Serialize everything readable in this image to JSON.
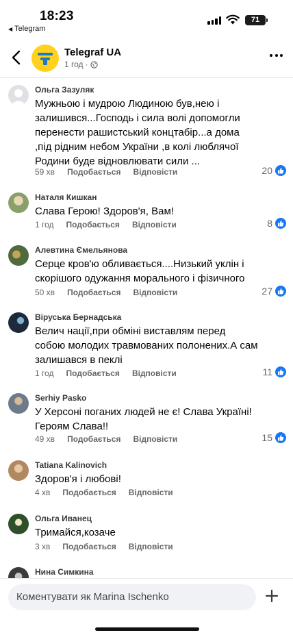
{
  "status_bar": {
    "time": "18:23",
    "back_app": "Telegram",
    "battery": "71"
  },
  "header": {
    "page_name": "Telegraf UA",
    "post_time": "1 год",
    "privacy_icon": "globe-icon"
  },
  "colors": {
    "accent": "#1877f2",
    "logo_bg": "#ffd21f",
    "logo_fg": "#1f7ac4",
    "meta": "#65676b"
  },
  "comments": [
    {
      "author": "Ольга Зазуляк",
      "text": "Мужньою і мудрою Людиною був,нею і залишився...Господь і сила волі допомогли перенести рашистський концтабір...а дома ,під рідним небом України ,в колі люблячої Родини буде відновлювати сили ...",
      "time": "59 хв",
      "like": "Подобається",
      "reply": "Відповісти",
      "reactions": "20"
    },
    {
      "author": "Наталя Кишкан",
      "text": "Слава Герою! Здоров'я, Вам!",
      "time": "1 год",
      "like": "Подобається",
      "reply": "Відповісти",
      "reactions": "8"
    },
    {
      "author": "Алевтина Ємельянова",
      "text": "Серце кров'ю обливається....Низький уклін і скорішого одужання морального і фізичного",
      "time": "50 хв",
      "like": "Подобається",
      "reply": "Відповісти",
      "reactions": "27"
    },
    {
      "author": "Віруська Бернадська",
      "text": "Велич нації,при обміні виставлям перед собою молодих травмованих полонених.А сам залишався в пеклі",
      "time": "1 год",
      "like": "Подобається",
      "reply": "Відповісти",
      "reactions": "11"
    },
    {
      "author": "Serhiy Pasko",
      "text": "У Херсоні поганих людей не є! Слава Україні! Героям Слава!!",
      "time": "49 хв",
      "like": "Подобається",
      "reply": "Відповісти",
      "reactions": "15"
    },
    {
      "author": "Tatiana Kalinovich",
      "text": "Здоров'я і любові!",
      "time": "4 хв",
      "like": "Подобається",
      "reply": "Відповісти",
      "reactions": ""
    },
    {
      "author": "Ольга Иванец",
      "text": "Тримайся,козаче",
      "time": "3 хв",
      "like": "Подобається",
      "reply": "Відповісти",
      "reactions": ""
    },
    {
      "author": "Нина Симкина",
      "text": "",
      "time": "",
      "like": "",
      "reply": "",
      "reactions": ""
    }
  ],
  "composer": {
    "placeholder": "Коментувати як Marina Ischenko"
  }
}
